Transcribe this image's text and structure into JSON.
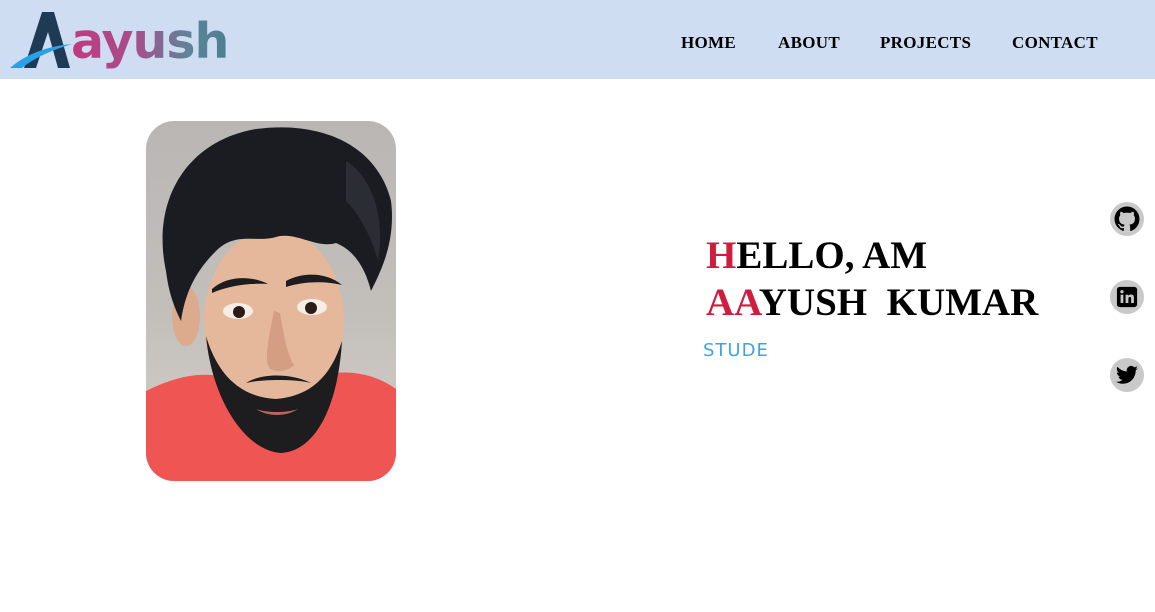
{
  "header": {
    "logo_text": "ayush",
    "nav": [
      {
        "label": "HOME"
      },
      {
        "label": "ABOUT"
      },
      {
        "label": "PROJECTS"
      },
      {
        "label": "CONTACT"
      }
    ]
  },
  "hero": {
    "line1_accent": "H",
    "line1_rest": "ELLO, AM",
    "line2_accent": "AA",
    "line2_rest": "YUSH  KUMAR",
    "role": "STUDE"
  },
  "social": [
    {
      "icon": "github-icon"
    },
    {
      "icon": "linkedin-icon"
    },
    {
      "icon": "twitter-icon"
    }
  ],
  "colors": {
    "nav_background": "#cfddf3",
    "accent_red": "#d01d3f",
    "role_blue": "#3ea3e6",
    "social_background": "#c9c9c9"
  }
}
